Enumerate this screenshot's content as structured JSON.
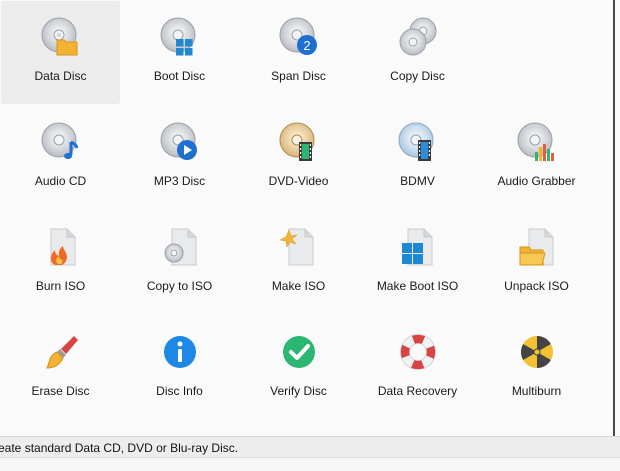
{
  "tiles": [
    {
      "label": "Data Disc",
      "icon": "data-disc-icon",
      "selected": true
    },
    {
      "label": "Boot Disc",
      "icon": "boot-disc-icon"
    },
    {
      "label": "Span Disc",
      "icon": "span-disc-icon",
      "badge": "2"
    },
    {
      "label": "Copy Disc",
      "icon": "copy-disc-icon"
    },
    {
      "label": "Audio CD",
      "icon": "audio-cd-icon"
    },
    {
      "label": "MP3 Disc",
      "icon": "mp3-disc-icon"
    },
    {
      "label": "DVD-Video",
      "icon": "dvd-video-icon"
    },
    {
      "label": "BDMV",
      "icon": "bdmv-icon"
    },
    {
      "label": "Audio Grabber",
      "icon": "audio-grabber-icon"
    },
    {
      "label": "Burn ISO",
      "icon": "burn-iso-icon"
    },
    {
      "label": "Copy to ISO",
      "icon": "copy-to-iso-icon"
    },
    {
      "label": "Make ISO",
      "icon": "make-iso-icon"
    },
    {
      "label": "Make Boot ISO",
      "icon": "make-boot-iso-icon"
    },
    {
      "label": "Unpack ISO",
      "icon": "unpack-iso-icon"
    },
    {
      "label": "Erase Disc",
      "icon": "erase-disc-icon"
    },
    {
      "label": "Disc Info",
      "icon": "disc-info-icon"
    },
    {
      "label": "Verify Disc",
      "icon": "verify-disc-icon"
    },
    {
      "label": "Data Recovery",
      "icon": "data-recovery-icon"
    },
    {
      "label": "Multiburn",
      "icon": "multiburn-icon"
    }
  ],
  "status": {
    "text": "eate standard Data CD, DVD or Blu-ray Disc."
  },
  "colors": {
    "selected_bg": "#ececec",
    "windows_blue": "#1e88d0",
    "folder": "#f2b233",
    "green": "#2bb673",
    "info_blue": "#1e88e5",
    "red": "#d84343"
  }
}
